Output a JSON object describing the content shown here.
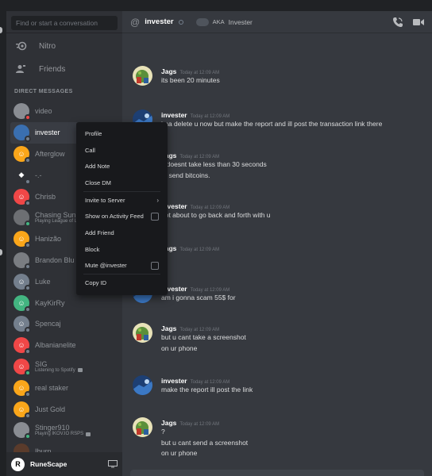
{
  "search": {
    "placeholder": "Find or start a conversation"
  },
  "nav": [
    {
      "label": "Nitro",
      "icon": "nitro-icon"
    },
    {
      "label": "Friends",
      "icon": "friends-icon"
    }
  ],
  "direct_messages_header": "DIRECT MESSAGES",
  "dms": [
    {
      "name": "video",
      "status": "dnd",
      "avatar_color": "#8a8d93",
      "glyph": ""
    },
    {
      "name": "invester",
      "status": "off",
      "avatar_color": "#3a6fb0",
      "glyph": "",
      "active": true
    },
    {
      "name": "Afterglow",
      "status": "off",
      "avatar_color": "#faa61a",
      "glyph": "☺"
    },
    {
      "name": "-.-",
      "status": "off",
      "avatar_color": "#2f3136",
      "glyph": "◆"
    },
    {
      "name": "Chrisb",
      "status": "off",
      "avatar_color": "#f04747",
      "glyph": "☺"
    },
    {
      "name": "Chasing Sun",
      "sub": "Playing League of Legends",
      "status": "on",
      "avatar_color": "#6d6f73",
      "glyph": ""
    },
    {
      "name": "Hanizão",
      "status": "off",
      "avatar_color": "#faa61a",
      "glyph": "☺"
    },
    {
      "name": "Brandon Blu",
      "status": "off",
      "avatar_color": "#7a7d82",
      "glyph": ""
    },
    {
      "name": "Luke",
      "status": "off",
      "avatar_color": "#747f8d",
      "glyph": "☺"
    },
    {
      "name": "KayKirRy",
      "status": "off",
      "avatar_color": "#43b581",
      "glyph": "☺"
    },
    {
      "name": "Spencaj",
      "status": "off",
      "avatar_color": "#747f8d",
      "glyph": "☺"
    },
    {
      "name": "Albanianelite",
      "status": "off",
      "avatar_color": "#f04747",
      "glyph": "☺"
    },
    {
      "name": "SIG",
      "sub": "Listening to Spotify",
      "status": "on",
      "avatar_color": "#f04747",
      "glyph": "☺"
    },
    {
      "name": "real staker",
      "status": "off",
      "avatar_color": "#faa61a",
      "glyph": "☺"
    },
    {
      "name": "Just Gold",
      "status": "off",
      "avatar_color": "#faa61a",
      "glyph": "☺"
    },
    {
      "name": "Stinger910",
      "sub": "Playing IKOV.IO RSPS",
      "status": "on",
      "avatar_color": "#8a8d93",
      "glyph": ""
    },
    {
      "name": "Iburn",
      "status": "off",
      "avatar_color": "#5a3b2b",
      "glyph": ""
    }
  ],
  "user_panel": {
    "name": "RuneScape",
    "avatar_glyph": "R"
  },
  "chat_header": {
    "name": "invester",
    "aka_label": "AKA",
    "aka_name": "Invester"
  },
  "messages": [
    {
      "author": "Jags",
      "time": "Today at 12:09 AM",
      "lines": [
        "its been 20 minutes"
      ],
      "avatar": "jags"
    },
    {
      "author": "invester",
      "time": "Today at 12:09 AM",
      "lines": [
        "ima delete u now but make the report and ill post the transaction link there"
      ],
      "avatar": "invester"
    },
    {
      "author": "Jags",
      "time": "Today at 12:09 AM",
      "lines": [
        "it doesnt take less than 30 seconds",
        "to send bitcoins."
      ],
      "avatar": "jags"
    },
    {
      "author": "invester",
      "time": "Today at 12:09 AM",
      "lines": [
        "not about to go back and forth with u"
      ],
      "avatar": "invester"
    },
    {
      "author": "Jags",
      "time": "Today at 12:09 AM",
      "lines": [],
      "avatar": "jags"
    },
    {
      "author": "invester",
      "time": "Today at 12:09 AM",
      "lines": [
        "am i gonna scam 55$ for"
      ],
      "avatar": "invester"
    },
    {
      "author": "Jags",
      "time": "Today at 12:09 AM",
      "lines": [
        "but u cant take a screenshot",
        "on ur phone"
      ],
      "avatar": "jags"
    },
    {
      "author": "invester",
      "time": "Today at 12:09 AM",
      "lines": [
        "make the report ill post the link"
      ],
      "avatar": "invester"
    },
    {
      "author": "Jags",
      "time": "Today at 12:09 AM",
      "lines": [
        "?",
        "but u cant send a screenshot",
        "on ur phone"
      ],
      "avatar": "jags"
    }
  ],
  "context_menu": [
    {
      "label": "Profile"
    },
    {
      "label": "Call"
    },
    {
      "label": "Add Note"
    },
    {
      "label": "Close DM"
    },
    {
      "sep": true
    },
    {
      "label": "Invite to Server",
      "arrow": true
    },
    {
      "label": "Show on Activity Feed",
      "checkbox": true
    },
    {
      "label": "Add Friend"
    },
    {
      "label": "Block"
    },
    {
      "label": "Mute @invester",
      "checkbox": true
    },
    {
      "sep": true
    },
    {
      "label": "Copy ID"
    }
  ]
}
